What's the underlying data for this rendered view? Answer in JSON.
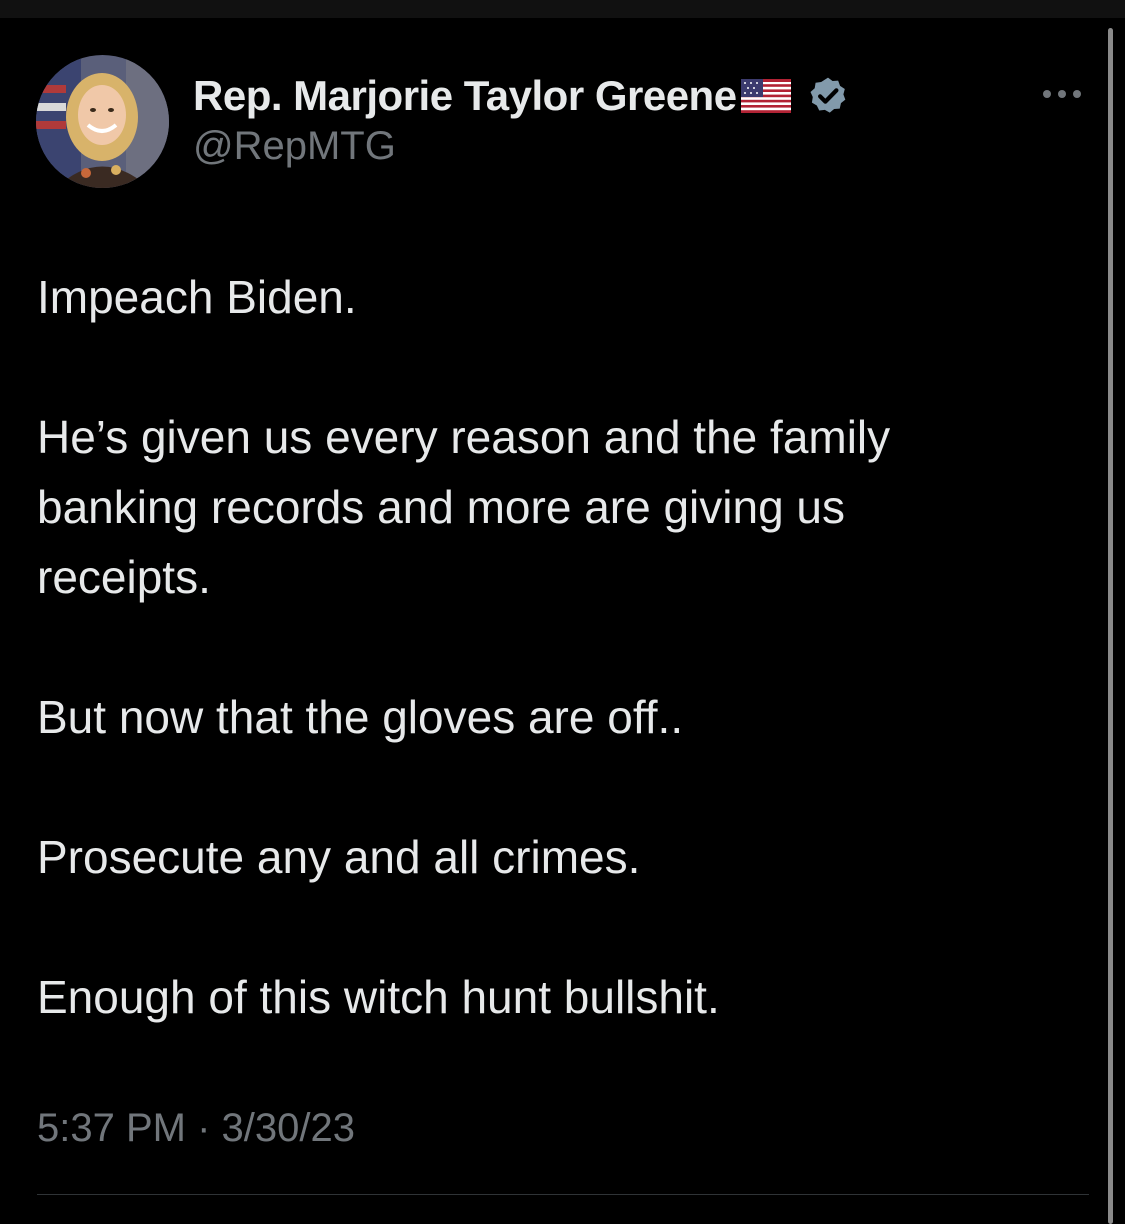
{
  "author": {
    "display_name": "Rep. Marjorie Taylor Greene",
    "handle": "@RepMTG",
    "flag_icon": "us-flag-icon",
    "verified_icon": "verified-badge-icon",
    "avatar_icon": "profile-photo"
  },
  "tweet": {
    "paragraphs": [
      "Impeach Biden.",
      "He’s given us every reason and the family banking records and more are giving us receipts.",
      "But now that the gloves are off..",
      "Prosecute any and all crimes.",
      "Enough of this witch hunt bullshit."
    ],
    "timestamp": "5:37 PM · 3/30/23"
  },
  "colors": {
    "background": "#000000",
    "primary_text": "#e7e9ea",
    "secondary_text": "#71767b",
    "verified_badge": "#829aab",
    "divider": "#2f3336"
  },
  "menu": {
    "more_icon": "more-options-icon"
  }
}
